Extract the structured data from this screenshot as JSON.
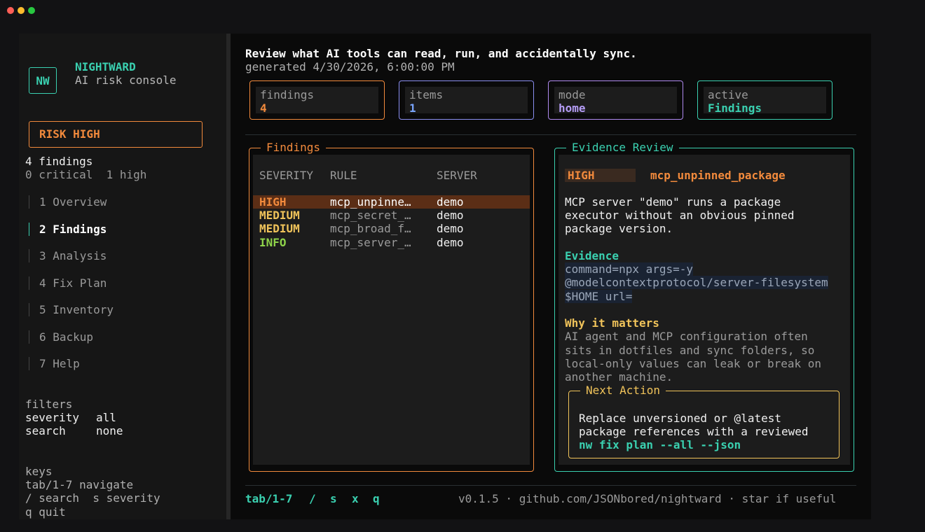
{
  "window": {
    "traffic_lights": [
      "#ff5f57",
      "#febc2e",
      "#28c840"
    ]
  },
  "brand": {
    "logo": "NW",
    "name": "NIGHTWARD",
    "subtitle": "AI risk console"
  },
  "risk": {
    "label": "RISK HIGH"
  },
  "summary": {
    "findings": "4 findings",
    "breakdown": "0 critical  1 high"
  },
  "nav": [
    {
      "label": "1 Overview",
      "active": false
    },
    {
      "label": "2 Findings",
      "active": true
    },
    {
      "label": "3 Analysis",
      "active": false
    },
    {
      "label": "4 Fix Plan",
      "active": false
    },
    {
      "label": "5 Inventory",
      "active": false
    },
    {
      "label": "6 Backup",
      "active": false
    },
    {
      "label": "7 Help",
      "active": false
    }
  ],
  "filters": {
    "title": "filters",
    "severity_label": "severity",
    "severity_value": "all",
    "search_label": "search",
    "search_value": "none"
  },
  "keys": {
    "title": "keys",
    "lines": [
      "tab/1-7 navigate",
      "/ search  s severity",
      "q quit"
    ]
  },
  "header": {
    "title": "Review what AI tools can read, run, and accidentally sync.",
    "generated": "generated 4/30/2026, 6:00:00 PM"
  },
  "stats": [
    {
      "label": "findings",
      "value": "4",
      "border": "#f28a3c",
      "color": "#f28a3c"
    },
    {
      "label": "items",
      "value": "1",
      "border": "#8a8ef0",
      "color": "#7aa6ff"
    },
    {
      "label": "mode",
      "value": "home",
      "border": "#b08af0",
      "color": "#b49cf5"
    },
    {
      "label": "active",
      "value": "Findings",
      "border": "#3ad0b0",
      "color": "#3ad0b0"
    }
  ],
  "findings": {
    "title": "Findings",
    "columns": [
      "SEVERITY",
      "RULE",
      "SERVER"
    ],
    "rows": [
      {
        "severity": "HIGH",
        "rule": "mcp_unpinne…",
        "server": "demo",
        "color": "#f28a3c",
        "selected": true
      },
      {
        "severity": "MEDIUM",
        "rule": "mcp_secret_…",
        "server": "demo",
        "color": "#f0c35a",
        "selected": false
      },
      {
        "severity": "MEDIUM",
        "rule": "mcp_broad_f…",
        "server": "demo",
        "color": "#f0c35a",
        "selected": false
      },
      {
        "severity": "INFO",
        "rule": "mcp_server_…",
        "server": "demo",
        "color": "#8fd44a",
        "selected": false
      }
    ]
  },
  "evidence": {
    "title": "Evidence Review",
    "badge": "HIGH",
    "rule": "mcp_unpinned_package",
    "description": [
      "MCP server \"demo\" runs a package",
      "executor without an obvious pinned",
      "package version."
    ],
    "evidence_title": "Evidence",
    "evidence_lines": [
      "command=npx args=-y",
      "@modelcontextprotocol/server-filesystem",
      "$HOME url="
    ],
    "why_title": "Why it matters",
    "why_lines": [
      "AI agent and MCP configuration often",
      "sits in dotfiles and sync folders, so",
      "local-only values can leak or break on",
      "another machine."
    ],
    "next_title": "Next Action",
    "next_lines": [
      "Replace unversioned or @latest",
      "package references with a reviewed"
    ],
    "next_command": "nw fix plan --all --json"
  },
  "footer": {
    "keys": [
      "tab/1-7",
      "/",
      "s",
      "x",
      "q"
    ],
    "info": "v0.1.5 · github.com/JSONbored/nightward · star if useful"
  }
}
